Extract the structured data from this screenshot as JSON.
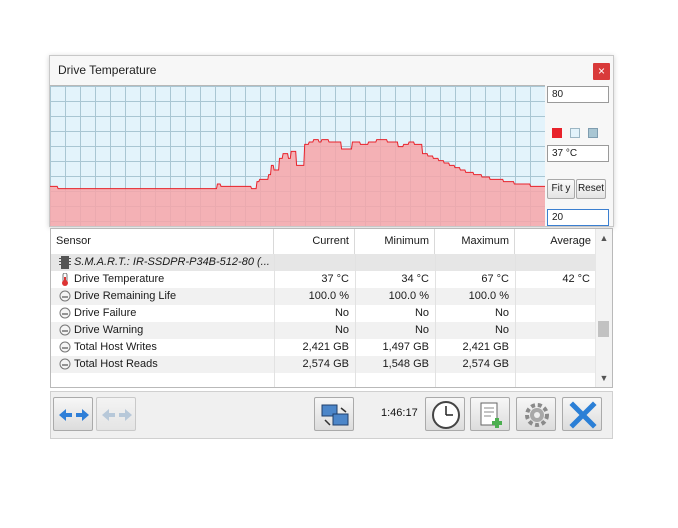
{
  "popup": {
    "title": "Drive Temperature",
    "close_glyph": "×",
    "max_value": "80",
    "current_value": "37 °C",
    "min_value": "20",
    "fit_label": "Fit y",
    "reset_label": "Reset",
    "colors": {
      "line": "#e8222b",
      "fill": "#f7a4a8",
      "background": "#e3f3fb",
      "grid": "#a9c6d3"
    },
    "swatches": [
      "#e8222b",
      "#e3f3fb",
      "#a9c6d3"
    ]
  },
  "table": {
    "columns": [
      "Sensor",
      "Current",
      "Minimum",
      "Maximum",
      "Average"
    ],
    "group": "S.M.A.R.T.: IR-SSDPR-P34B-512-80 (...",
    "rows": [
      {
        "icon": "thermometer-icon",
        "name": "Drive Temperature",
        "current": "37 °C",
        "minimum": "34 °C",
        "maximum": "67 °C",
        "average": "42 °C"
      },
      {
        "icon": "gauge-icon",
        "name": "Drive Remaining Life",
        "current": "100.0 %",
        "minimum": "100.0 %",
        "maximum": "100.0 %",
        "average": ""
      },
      {
        "icon": "gauge-icon",
        "name": "Drive Failure",
        "current": "No",
        "minimum": "No",
        "maximum": "No",
        "average": ""
      },
      {
        "icon": "gauge-icon",
        "name": "Drive Warning",
        "current": "No",
        "minimum": "No",
        "maximum": "No",
        "average": ""
      },
      {
        "icon": "gauge-icon",
        "name": "Total Host Writes",
        "current": "2,421 GB",
        "minimum": "1,497 GB",
        "maximum": "2,421 GB",
        "average": ""
      },
      {
        "icon": "gauge-icon",
        "name": "Total Host Reads",
        "current": "2,574 GB",
        "minimum": "1,548 GB",
        "maximum": "2,574 GB",
        "average": ""
      }
    ]
  },
  "toolbar": {
    "elapsed": "1:46:17"
  },
  "chart_data": {
    "type": "area",
    "ylim": [
      20,
      80
    ],
    "values": [
      37,
      37,
      37,
      37,
      37,
      37,
      37,
      37,
      37,
      36,
      36,
      36,
      36,
      36,
      36,
      36,
      36,
      36,
      36,
      36,
      36,
      36,
      36,
      36,
      36,
      36,
      36,
      36,
      36,
      36,
      36,
      36,
      36,
      36,
      36,
      36,
      36,
      36,
      36,
      36,
      36,
      36,
      36,
      36,
      36,
      36,
      36,
      36,
      36,
      36,
      36,
      36,
      36,
      36,
      36,
      36,
      36,
      36,
      36,
      36,
      36,
      36,
      36,
      36,
      36,
      36,
      36,
      36,
      36,
      36,
      36,
      36,
      36,
      36,
      36,
      36,
      36,
      36,
      36,
      36,
      36,
      36,
      36,
      36,
      36,
      36,
      36,
      36,
      36,
      36,
      36,
      36,
      36,
      36,
      36,
      36,
      36,
      36,
      36,
      36,
      36,
      36,
      36,
      36,
      36,
      36,
      36,
      36,
      36,
      36,
      36,
      36,
      36,
      36,
      36,
      36,
      36,
      36,
      36,
      36,
      36,
      36,
      36,
      36,
      36,
      36,
      36,
      36,
      36,
      36,
      36,
      36,
      36,
      36,
      36,
      36,
      36,
      36,
      36,
      36,
      36,
      36,
      36,
      36,
      36,
      36,
      36,
      36,
      36,
      36,
      36,
      36,
      36,
      36,
      36,
      36,
      36,
      36,
      36,
      36,
      36,
      36,
      36,
      36,
      36,
      36,
      36,
      36,
      36,
      36,
      36,
      36,
      36,
      36,
      36,
      36,
      36,
      36,
      36,
      36,
      36,
      36,
      36,
      36,
      36,
      36,
      38,
      38,
      38,
      38,
      37,
      37,
      37,
      37,
      37,
      37,
      37,
      37,
      37,
      37,
      37,
      37,
      37,
      37,
      37,
      37,
      37,
      37,
      37,
      37,
      37,
      37,
      37,
      37,
      37,
      37,
      37,
      37,
      37,
      37,
      37,
      37,
      37,
      37,
      36,
      36,
      36,
      36,
      36,
      36,
      39,
      39,
      39,
      40,
      40,
      40,
      40,
      40,
      40,
      40,
      40,
      40,
      40,
      42,
      42,
      42,
      46,
      46,
      46,
      44,
      44,
      44,
      44,
      44,
      44,
      49,
      49,
      49,
      49,
      51,
      51,
      51,
      51,
      51,
      51,
      49,
      49,
      49,
      52,
      52,
      52,
      52,
      52,
      52,
      46,
      46,
      46,
      46,
      46,
      46,
      46,
      46,
      46,
      55,
      55,
      55,
      55,
      55,
      56,
      56,
      56,
      56,
      56,
      57,
      57,
      57,
      57,
      57,
      57,
      56,
      56,
      56,
      57,
      57,
      57,
      57,
      57,
      57,
      57,
      57,
      56,
      56,
      56,
      56,
      56,
      56,
      56,
      56,
      56,
      56,
      56,
      56,
      56,
      56,
      53,
      53,
      53,
      53,
      53,
      53,
      53,
      53,
      53,
      53,
      53,
      53,
      56,
      56,
      56,
      56,
      56,
      56,
      56,
      56,
      56,
      55,
      55,
      55,
      55,
      55,
      55,
      55,
      55,
      55,
      56,
      56,
      56,
      56,
      56,
      56,
      56,
      56,
      56,
      57,
      57,
      57,
      57,
      57,
      57,
      57,
      57,
      57,
      57,
      57,
      57,
      56,
      56,
      56,
      56,
      56,
      56,
      56,
      56,
      56,
      56,
      56,
      56,
      54,
      54,
      54,
      54,
      54,
      54,
      55,
      55,
      55,
      55,
      55,
      55,
      56,
      56,
      56,
      56,
      56,
      56,
      55,
      55,
      55,
      55,
      55,
      55,
      55,
      55,
      55,
      51,
      51,
      51,
      51,
      51,
      51,
      50,
      50,
      50,
      50,
      50,
      50,
      49,
      49,
      49,
      49,
      49,
      49,
      48,
      48,
      48,
      48,
      48,
      48,
      47,
      47,
      47,
      47,
      47,
      47,
      46,
      46,
      46,
      46,
      46,
      46,
      45,
      45,
      45,
      45,
      45,
      45,
      44,
      44,
      44,
      44,
      44,
      44,
      43,
      43,
      43,
      43,
      43,
      43,
      43,
      43,
      43,
      42,
      42,
      42,
      42,
      42,
      42,
      42,
      42,
      42,
      41,
      41,
      41,
      41,
      41,
      41,
      41,
      41,
      41,
      40,
      40,
      40,
      40,
      40,
      40,
      40,
      40,
      40,
      40,
      40,
      40,
      40,
      40,
      40,
      39,
      39,
      39,
      39,
      39,
      39,
      39,
      39,
      39,
      39,
      39,
      39,
      38,
      38,
      38,
      38,
      38,
      38,
      38,
      38,
      38,
      38,
      38,
      38,
      38,
      38,
      38,
      38,
      38,
      38,
      37,
      37,
      37,
      37,
      37,
      37,
      37,
      37,
      37,
      37,
      37,
      37,
      37,
      37,
      37,
      37,
      37
    ]
  }
}
